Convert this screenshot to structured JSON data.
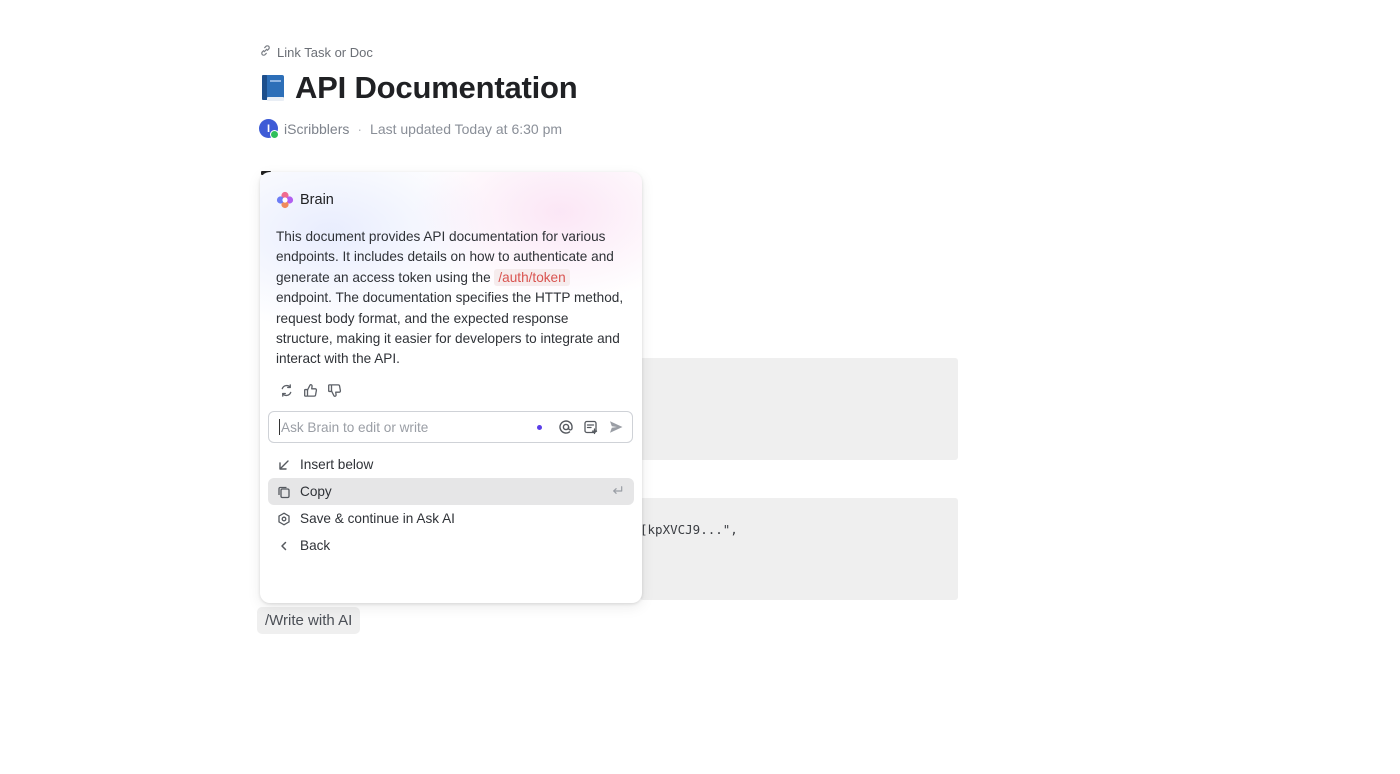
{
  "header": {
    "link_task_label": "Link Task or Doc",
    "title": "API Documentation",
    "author_initial": "I",
    "author": "iScribblers",
    "separator": "·",
    "last_updated": "Last updated Today at 6:30 pm"
  },
  "background": {
    "code_snippet": "[kpXVCJ9...\","
  },
  "ai_panel": {
    "brand": "Brain",
    "summary_before": "This document provides API documentation for various endpoints. It includes details on how to authenticate and generate an access token using the ",
    "summary_code": "/auth/token",
    "summary_after": " endpoint. The documentation specifies the HTTP method, request body format, and the expected response structure, making it easier for developers to integrate and interact with the API.",
    "ask_placeholder": "Ask Brain to edit or write",
    "ask_value": "",
    "menu": [
      {
        "label": "Insert below",
        "icon": "insert-below-icon"
      },
      {
        "label": "Copy",
        "icon": "copy-icon",
        "shortcut": "enter-key-icon"
      },
      {
        "label": "Save & continue in Ask AI",
        "icon": "ai-save-icon"
      },
      {
        "label": "Back",
        "icon": "chevron-left-icon"
      }
    ]
  },
  "write_with_ai_chip": "/Write with AI",
  "colors": {
    "accent_purple": "#5a3ee8",
    "avatar_blue": "#3d5bd6",
    "online_green": "#2fbf5b",
    "inline_code_red": "#d9534f"
  }
}
